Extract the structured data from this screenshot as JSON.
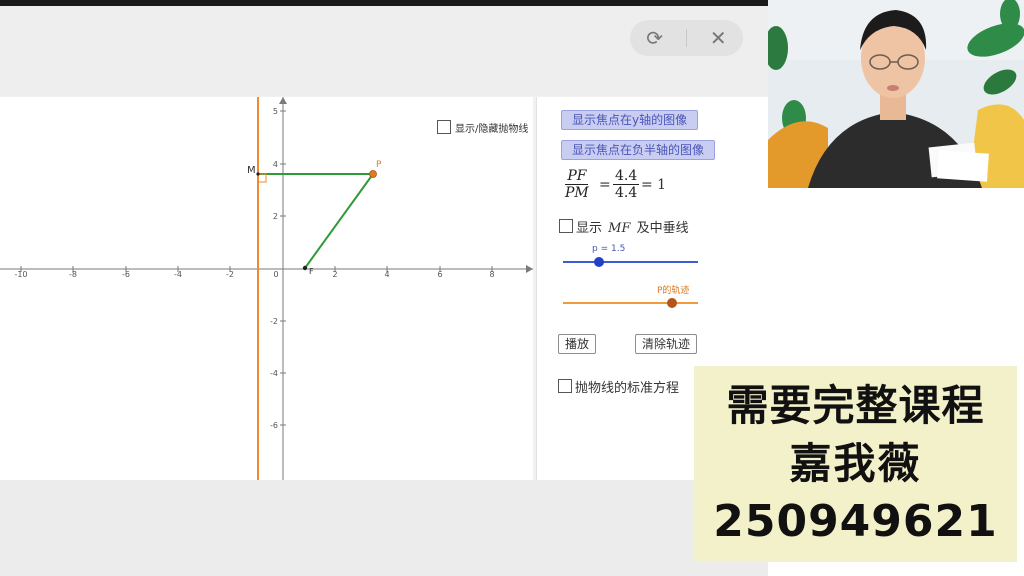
{
  "window_controls": {
    "refresh_icon": "refresh-icon",
    "close_icon": "close-icon",
    "refresh_glyph": "⟳",
    "close_glyph": "✕"
  },
  "graph": {
    "x_tick_labels": [
      "-10",
      "-8",
      "-6",
      "-4",
      "-2",
      "0",
      "2",
      "4",
      "6",
      "8"
    ],
    "y_tick_labels": [
      "5",
      "4",
      "2",
      "-2",
      "-4",
      "-6"
    ],
    "point_m_label": "M",
    "point_p_label": "P",
    "point_f_label": "F",
    "checkbox_label": "显示/隐藏抛物线",
    "colors": {
      "directrix": "#f08a2c",
      "segment": "#2e9b3a",
      "point": "#e07a22"
    }
  },
  "panel": {
    "btn_y_axis": "显示焦点在y轴的图像",
    "btn_neg_half_axis": "显示焦点在负半轴的图像",
    "ratio_pf": "PF",
    "ratio_pm": "PM",
    "ratio_eq": "=",
    "ratio_num": "4.4",
    "ratio_den": "4.4",
    "ratio_result": "= 1",
    "show_label_prefix": "显示",
    "show_label_math": "MF",
    "show_label_suffix": "及中垂线",
    "slider_p_label": "p = 1.5",
    "slider_trace_label": "P的轨迹",
    "play_button": "播放",
    "clear_trace_button": "清除轨迹",
    "standard_eq_label": "抛物线的标准方程",
    "colors": {
      "slider_blue": "#3f5bd3",
      "slider_orange": "#f09a3e"
    }
  },
  "ad": {
    "line1": "需要完整课程",
    "line2": "嘉我薇",
    "line3": "250949621"
  }
}
